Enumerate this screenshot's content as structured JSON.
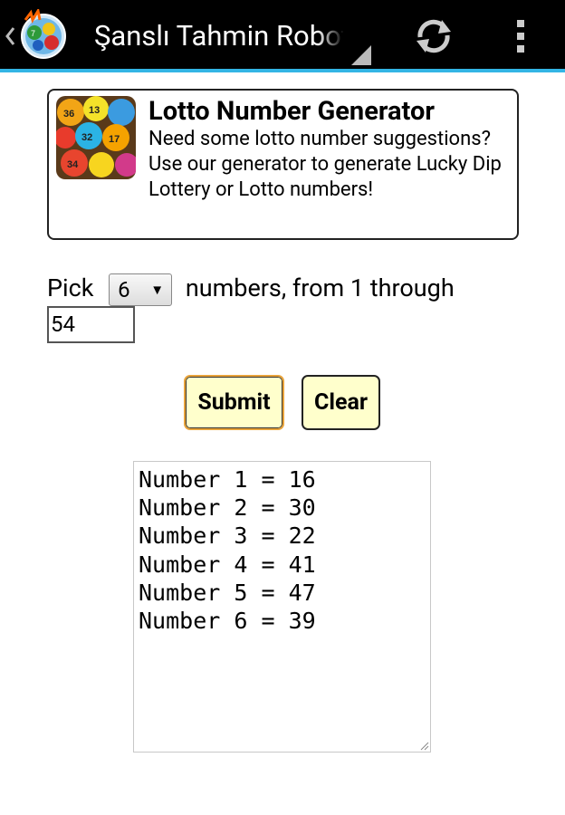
{
  "actionbar": {
    "title": "Şanslı Tahmin Robotu",
    "accent_color": "#33b5e5",
    "icons": [
      "app-lottery-icon",
      "refresh-icon",
      "overflow-menu-icon"
    ]
  },
  "card": {
    "title": "Lotto Number Generator",
    "text": "Need some lotto number suggestions? Use our generator to generate Lucky Dip Lottery or Lotto numbers!",
    "thumbnail": "lottery-balls-image"
  },
  "form": {
    "pick_label": "Pick",
    "count_selected": "6",
    "range_label": "numbers, from 1 through",
    "max_value": "54",
    "submit_label": "Submit",
    "clear_label": "Clear",
    "button_color": "#ffffcc"
  },
  "output": {
    "lines": [
      "Number 1 = 16",
      "Number 2 = 30",
      "Number 3 = 22",
      "Number 4 = 41",
      "Number 5 = 47",
      "Number 6 = 39"
    ]
  }
}
